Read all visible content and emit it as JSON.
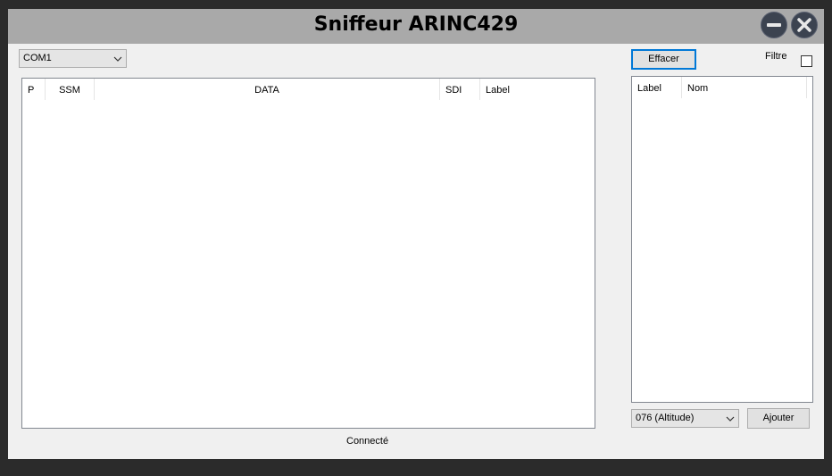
{
  "window": {
    "title": "Sniffeur ARINC429"
  },
  "port_select": {
    "value": "COM1"
  },
  "main_table": {
    "columns": [
      "P",
      "SSM",
      "DATA",
      "SDI",
      "Label"
    ]
  },
  "status": "Connecté",
  "clear_button": "Effacer",
  "filter": {
    "label": "Filtre",
    "checked": false
  },
  "label_table": {
    "columns": [
      "Label",
      "Nom"
    ]
  },
  "label_select": {
    "value": "076 (Altitude)"
  },
  "add_button": "Ajouter",
  "colors": {
    "titlebar": "#a9a9a9",
    "window_bg": "#f0f0f0",
    "focus_accent": "#0078d7",
    "outer_bg": "#2b2b2b"
  },
  "icons": [
    "minimize-icon",
    "close-icon",
    "chevron-down-icon"
  ]
}
